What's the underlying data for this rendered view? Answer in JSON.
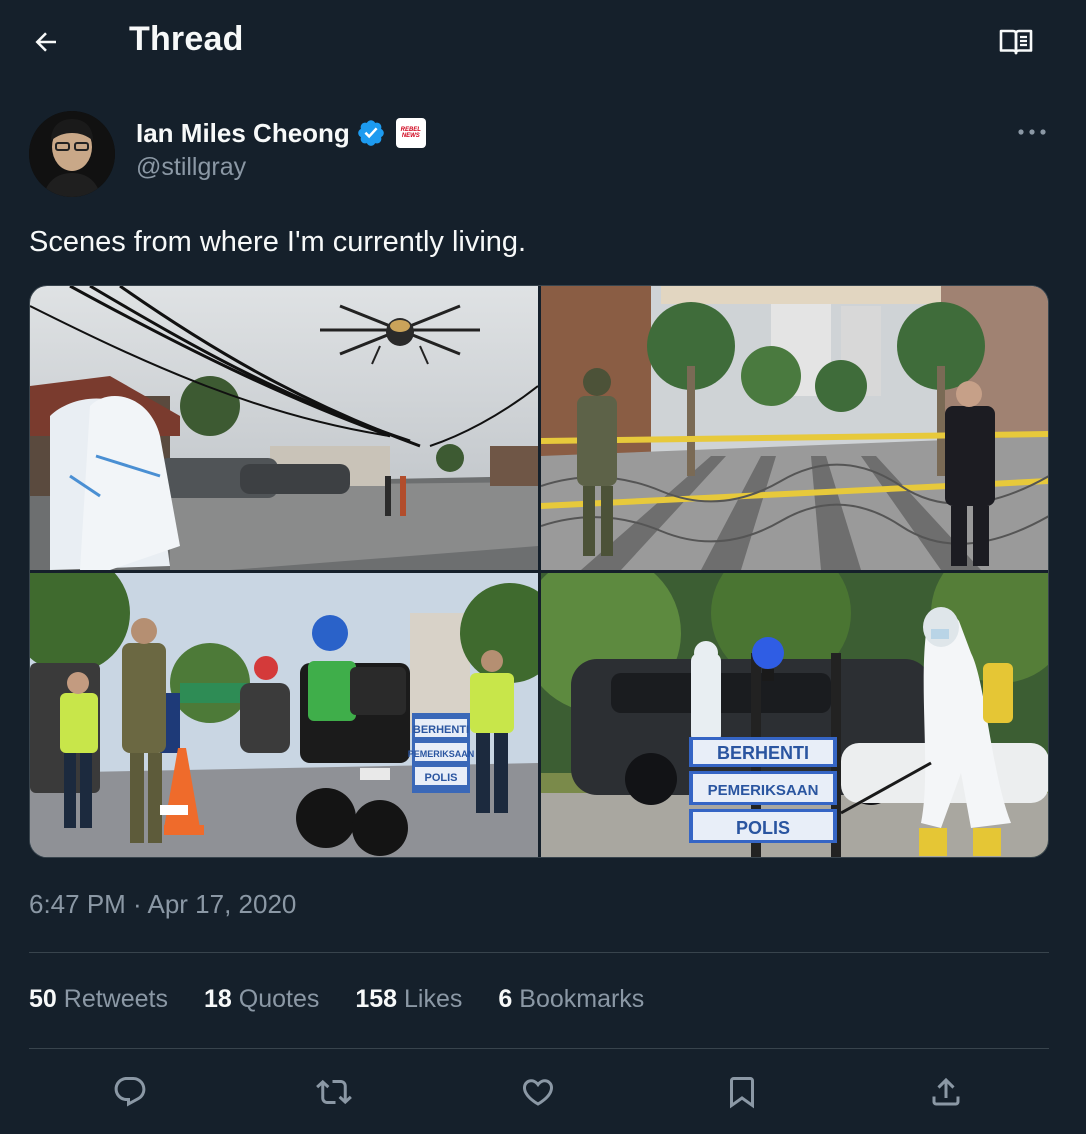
{
  "header": {
    "title": "Thread",
    "back_icon": "arrow-left-icon",
    "reader_icon": "reader-mode-icon"
  },
  "author": {
    "name": "Ian Miles Cheong",
    "handle": "@stillgray",
    "verified_icon": "verified-badge-icon",
    "affiliation_badge_text": "REBEL NEWS"
  },
  "tweet": {
    "text": "Scenes from where I'm currently living.",
    "timestamp": "6:47 PM · Apr 17, 2020",
    "photos": [
      {
        "alt": "drone-spraying-street-photo"
      },
      {
        "alt": "barbed-wire-roadblock-photo"
      },
      {
        "alt": "police-checkpoint-motorbike-photo",
        "sign_lines": [
          "BERHENTI",
          "PEMERIKSAAN",
          "POLIS"
        ]
      },
      {
        "alt": "disinfection-worker-photo",
        "sign_lines": [
          "BERHENTI",
          "PEMERIKSAAN",
          "POLIS"
        ]
      }
    ]
  },
  "stats": [
    {
      "count": "50",
      "label": "Retweets"
    },
    {
      "count": "18",
      "label": "Quotes"
    },
    {
      "count": "158",
      "label": "Likes"
    },
    {
      "count": "6",
      "label": "Bookmarks"
    }
  ],
  "colors": {
    "background": "#15202b",
    "text_primary": "#f7f9f9",
    "text_secondary": "#8b98a5",
    "divider": "#38444d",
    "verified": "#1d9bf0"
  }
}
